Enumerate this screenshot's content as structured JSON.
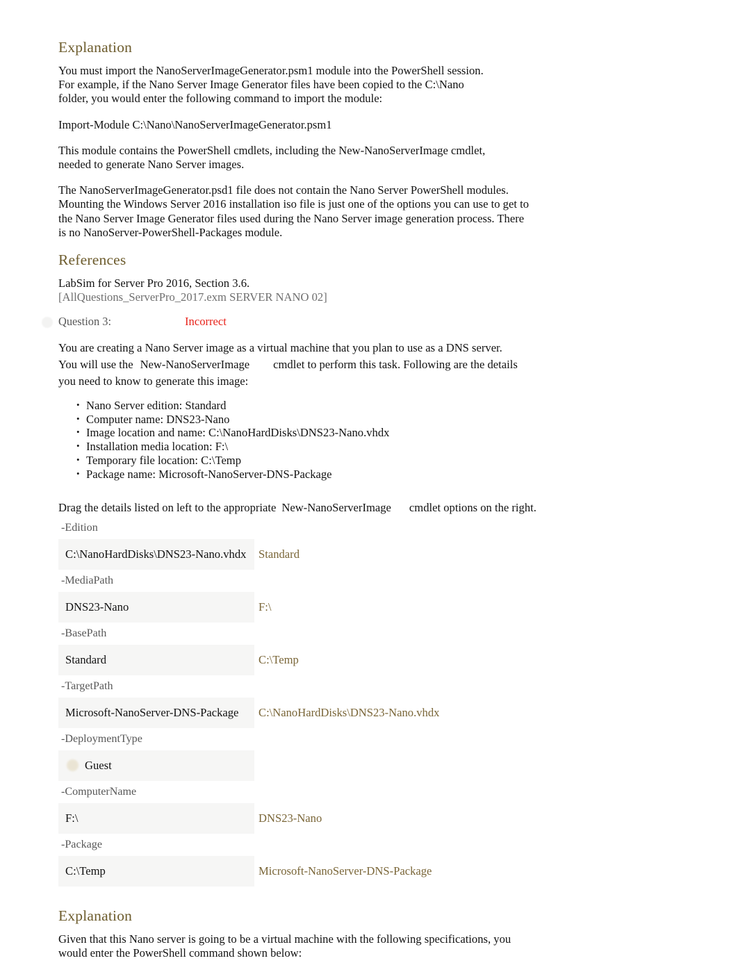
{
  "explanation_top": {
    "heading": "Explanation",
    "paragraphs": [
      "You must import the NanoServerImageGenerator.psm1 module into the PowerShell session. For example, if the Nano Server Image Generator files have been copied to the C:\\Nano folder, you would enter the following command to import the module:",
      "Import-Module C:\\Nano\\NanoServerImageGenerator.psm1",
      "This module contains the PowerShell cmdlets, including the New-NanoServerImage cmdlet, needed to generate Nano Server images.",
      "The NanoServerImageGenerator.psd1 file does not contain the Nano Server PowerShell modules. Mounting the Windows Server 2016 installation iso file is just one of the options you can use to get to the Nano Server Image Generator files used during the Nano Server image generation process. There is no NanoServer-PowerShell-Packages module."
    ]
  },
  "references": {
    "heading": "References",
    "primary": "LabSim for Server Pro 2016, Section 3.6.",
    "secondary": "[AllQuestions_ServerPro_2017.exm SERVER NANO 02]"
  },
  "question": {
    "label": "Question 3:",
    "status": "Incorrect",
    "status_color": "#e8241c",
    "intro_line1": "You are creating a Nano Server image as a virtual machine that you plan to use as a DNS server.",
    "intro_line2_prefix": "You will use the",
    "intro_cmdlet": "New-NanoServerImage",
    "intro_line2_suffix": "cmdlet to perform this task. Following are the details",
    "intro_line3": "you need to know to generate this image:",
    "details": [
      "Nano Server edition: Standard",
      "Computer name: DNS23-Nano",
      "Image location and name: C:\\NanoHardDisks\\DNS23-Nano.vhdx",
      "Installation media location: F:\\",
      "Temporary file location: C:\\Temp",
      "Package name: Microsoft-NanoServer-DNS-Package"
    ],
    "drag_prefix": "Drag the details listed on left to the appropriate",
    "drag_cmdlet": "New-NanoServerImage",
    "drag_suffix": "cmdlet options on the right."
  },
  "matching": {
    "rows": [
      {
        "parameter": "-Edition",
        "user_answer": "C:\\NanoHardDisks\\DNS23-Nano.vhdx",
        "correct_answer": "Standard",
        "has_marker": false
      },
      {
        "parameter": "-MediaPath",
        "user_answer": "DNS23-Nano",
        "correct_answer": "F:\\",
        "has_marker": false
      },
      {
        "parameter": "-BasePath",
        "user_answer": "Standard",
        "correct_answer": "C:\\Temp",
        "has_marker": false
      },
      {
        "parameter": "-TargetPath",
        "user_answer": "Microsoft-NanoServer-DNS-Package",
        "correct_answer": "C:\\NanoHardDisks\\DNS23-Nano.vhdx",
        "has_marker": false
      },
      {
        "parameter": "-DeploymentType",
        "user_answer": "Guest",
        "correct_answer": "",
        "has_marker": true
      },
      {
        "parameter": "-ComputerName",
        "user_answer": "F:\\",
        "correct_answer": "DNS23-Nano",
        "has_marker": false
      },
      {
        "parameter": "-Package",
        "user_answer": "C:\\Temp",
        "correct_answer": "Microsoft-NanoServer-DNS-Package",
        "has_marker": false
      }
    ]
  },
  "explanation_bottom": {
    "heading": "Explanation",
    "paragraph": "Given that this Nano server is going to be a virtual machine with the following specifications, you would enter the PowerShell command shown below:"
  },
  "colors": {
    "heading": "#6d5c2d",
    "correct_answer": "#7a6638",
    "parameter_label": "#585858",
    "status": "#e8241c"
  }
}
